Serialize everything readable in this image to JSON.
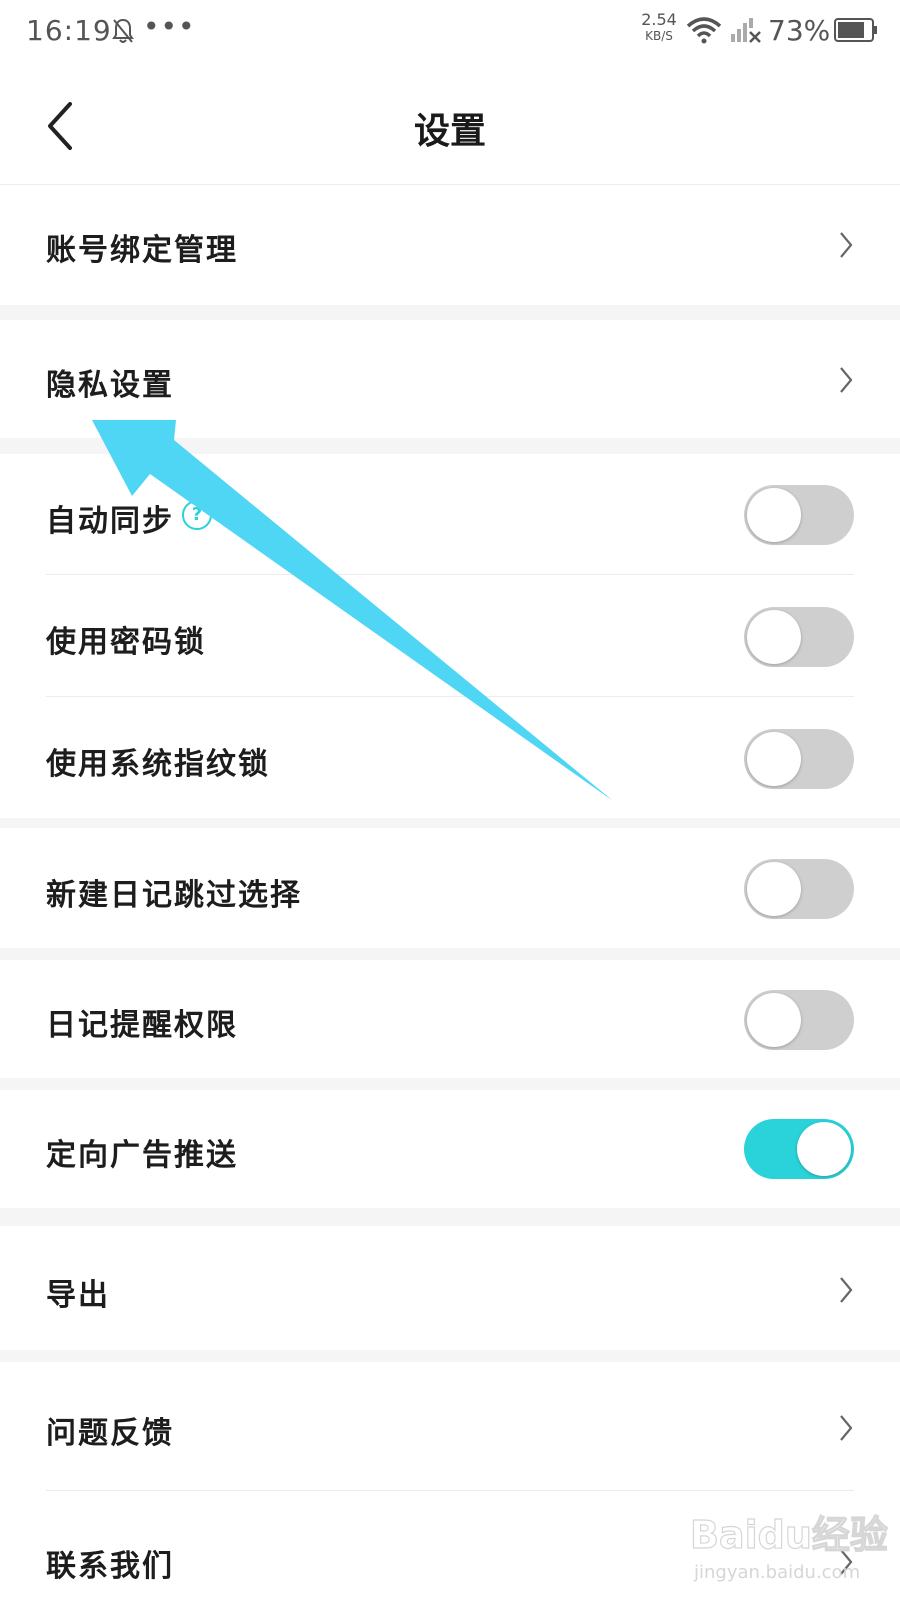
{
  "status_bar": {
    "time": "16:19",
    "dots": "•••",
    "net_speed_value": "2.54",
    "net_speed_unit": "KB/S",
    "battery": "73%",
    "icons": [
      "bell-off-icon",
      "wifi-icon",
      "no-signal-icon",
      "battery-icon"
    ]
  },
  "header": {
    "title": "设置",
    "back_icon": "chevron-left-icon"
  },
  "settings": {
    "account_binding": "账号绑定管理",
    "privacy": "隐私设置",
    "auto_sync": "自动同步",
    "auto_sync_help": "?",
    "password_lock": "使用密码锁",
    "fingerprint_lock": "使用系统指纹锁",
    "skip_selection": "新建日记跳过选择",
    "reminder_permission": "日记提醒权限",
    "targeted_ads": "定向广告推送",
    "export": "导出",
    "feedback": "问题反馈",
    "contact": "联系我们"
  },
  "toggles": {
    "auto_sync": false,
    "password_lock": false,
    "fingerprint_lock": false,
    "skip_selection": false,
    "reminder_permission": false,
    "targeted_ads": true
  },
  "colors": {
    "accent": "#2ad3d9",
    "annotation_arrow": "#4fd6f5",
    "toggle_off": "#cfcfcf"
  },
  "watermark": {
    "brand": "Baidu经验",
    "url": "jingyan.baidu.com"
  }
}
